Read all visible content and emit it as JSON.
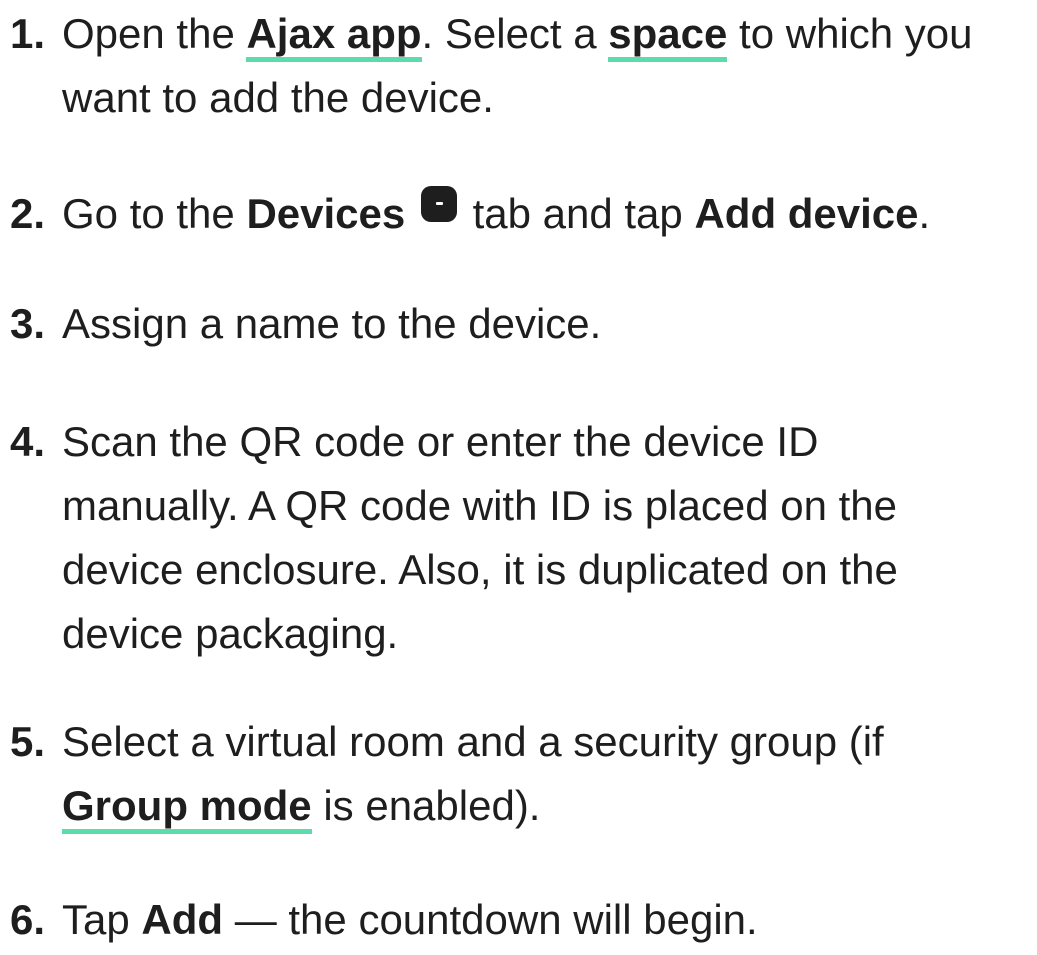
{
  "steps": [
    {
      "number": "1.",
      "t1": "Open the ",
      "link1": "Ajax app",
      "t2": ". Select a ",
      "link2": "space",
      "t3": " to which you want to add the device."
    },
    {
      "number": "2.",
      "t1": "Go to the ",
      "bold1": "Devices",
      "icon": "devices-tab-icon",
      "t2": " tab and tap ",
      "bold2": "Add device",
      "t3": "."
    },
    {
      "number": "3.",
      "t1": "Assign a name to the device."
    },
    {
      "number": "4.",
      "t1": "Scan the QR code or enter the device ID manually. A QR code with ID is placed on the device enclosure. Also, it is duplicated on the device packaging."
    },
    {
      "number": "5.",
      "t1": "Select a virtual room and a security group (if ",
      "link1": "Group mode",
      "t2": " is enabled)."
    },
    {
      "number": "6.",
      "t1": "Tap ",
      "bold1": "Add",
      "t2": " — the countdown will begin."
    }
  ],
  "colors": {
    "text": "#1e1e1e",
    "link_underline": "#5bdcaa",
    "background": "#ffffff"
  }
}
